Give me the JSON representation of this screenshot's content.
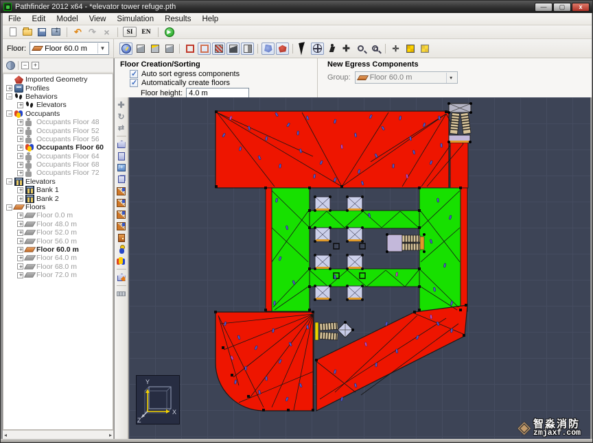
{
  "window": {
    "title": "Pathfinder 2012 x64 - *elevator tower refuge.pth"
  },
  "menu": {
    "items": [
      "File",
      "Edit",
      "Model",
      "View",
      "Simulation",
      "Results",
      "Help"
    ]
  },
  "toolbar": {
    "si": "SI",
    "en": "EN"
  },
  "floor_selector": {
    "label": "Floor:",
    "value": "Floor 60.0 m"
  },
  "panels": {
    "floor_creation": {
      "title": "Floor Creation/Sorting",
      "auto_sort": "Auto sort egress components",
      "auto_sort_checked": true,
      "auto_create": "Automatically create floors",
      "auto_create_checked": true,
      "height_label": "Floor height:",
      "height_value": "4.0 m"
    },
    "new_egress": {
      "title": "New Egress Components",
      "group_label": "Group:",
      "group_value": "Floor 60.0 m"
    }
  },
  "tree": {
    "items": [
      {
        "label": "Imported Geometry"
      },
      {
        "label": "Profiles"
      },
      {
        "label": "Behaviors"
      },
      {
        "label": "Elevators"
      },
      {
        "label": "Occupants"
      },
      {
        "label": "Occupants Floor 48"
      },
      {
        "label": "Occupants Floor 52"
      },
      {
        "label": "Occupants Floor 56"
      },
      {
        "label": "Occupants Floor 60"
      },
      {
        "label": "Occupants Floor 64"
      },
      {
        "label": "Occupants Floor 68"
      },
      {
        "label": "Occupants Floor 72"
      },
      {
        "label": "Elevators"
      },
      {
        "label": "Bank 1"
      },
      {
        "label": "Bank 2"
      },
      {
        "label": "Floors"
      },
      {
        "label": "Floor 0.0 m"
      },
      {
        "label": "Floor 48.0 m"
      },
      {
        "label": "Floor 52.0 m"
      },
      {
        "label": "Floor 56.0 m"
      },
      {
        "label": "Floor 60.0 m"
      },
      {
        "label": "Floor 64.0 m"
      },
      {
        "label": "Floor 68.0 m"
      },
      {
        "label": "Floor 72.0 m"
      }
    ]
  },
  "nav_axes": {
    "x": "X",
    "y": "Y",
    "z": "Z"
  },
  "watermark": {
    "name": "智淼消防",
    "url": "zmjaxf.com",
    "logo_glyph": "◈"
  }
}
